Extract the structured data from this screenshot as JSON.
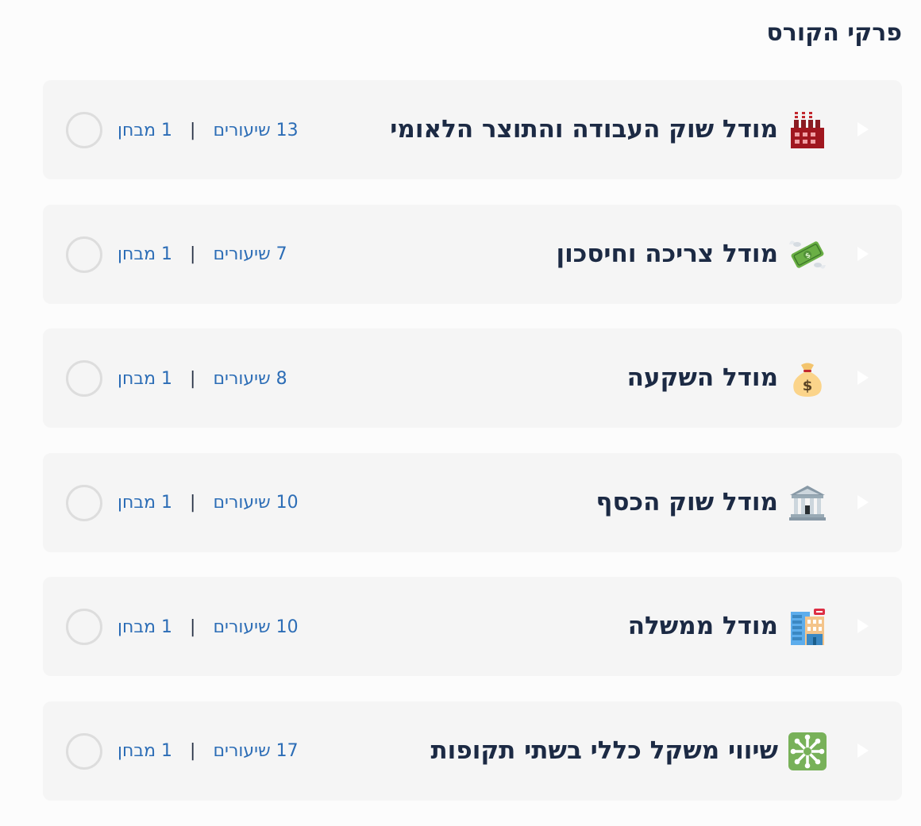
{
  "page": {
    "title": "פרקי הקורס"
  },
  "colors": {
    "title_text": "#1c2a44",
    "meta_text": "#2c6db6",
    "card_background": "#f5f5f5",
    "circle_border": "#dddddd"
  },
  "chapters": [
    {
      "icon": "factory-icon",
      "title": "מודל שוק העבודה והתוצר הלאומי",
      "lessons": "13 שיעורים",
      "divider": "|",
      "exams": "1 מבחן"
    },
    {
      "icon": "money-with-wings-icon",
      "title": "מודל צריכה וחיסכון",
      "lessons": "7 שיעורים",
      "divider": "|",
      "exams": "1 מבחן"
    },
    {
      "icon": "money-bag-icon",
      "title": "מודל השקעה",
      "lessons": "8 שיעורים",
      "divider": "|",
      "exams": "1 מבחן"
    },
    {
      "icon": "bank-icon",
      "title": "מודל שוק הכסף",
      "lessons": "10 שיעורים",
      "divider": "|",
      "exams": "1 מבחן"
    },
    {
      "icon": "hotel-icon",
      "title": "מודל ממשלה",
      "lessons": "10 שיעורים",
      "divider": "|",
      "exams": "1 מבחן"
    },
    {
      "icon": "sparkle-icon",
      "title": "שיווי משקל כללי בשתי תקופות",
      "lessons": "17 שיעורים",
      "divider": "|",
      "exams": "1 מבחן"
    }
  ]
}
